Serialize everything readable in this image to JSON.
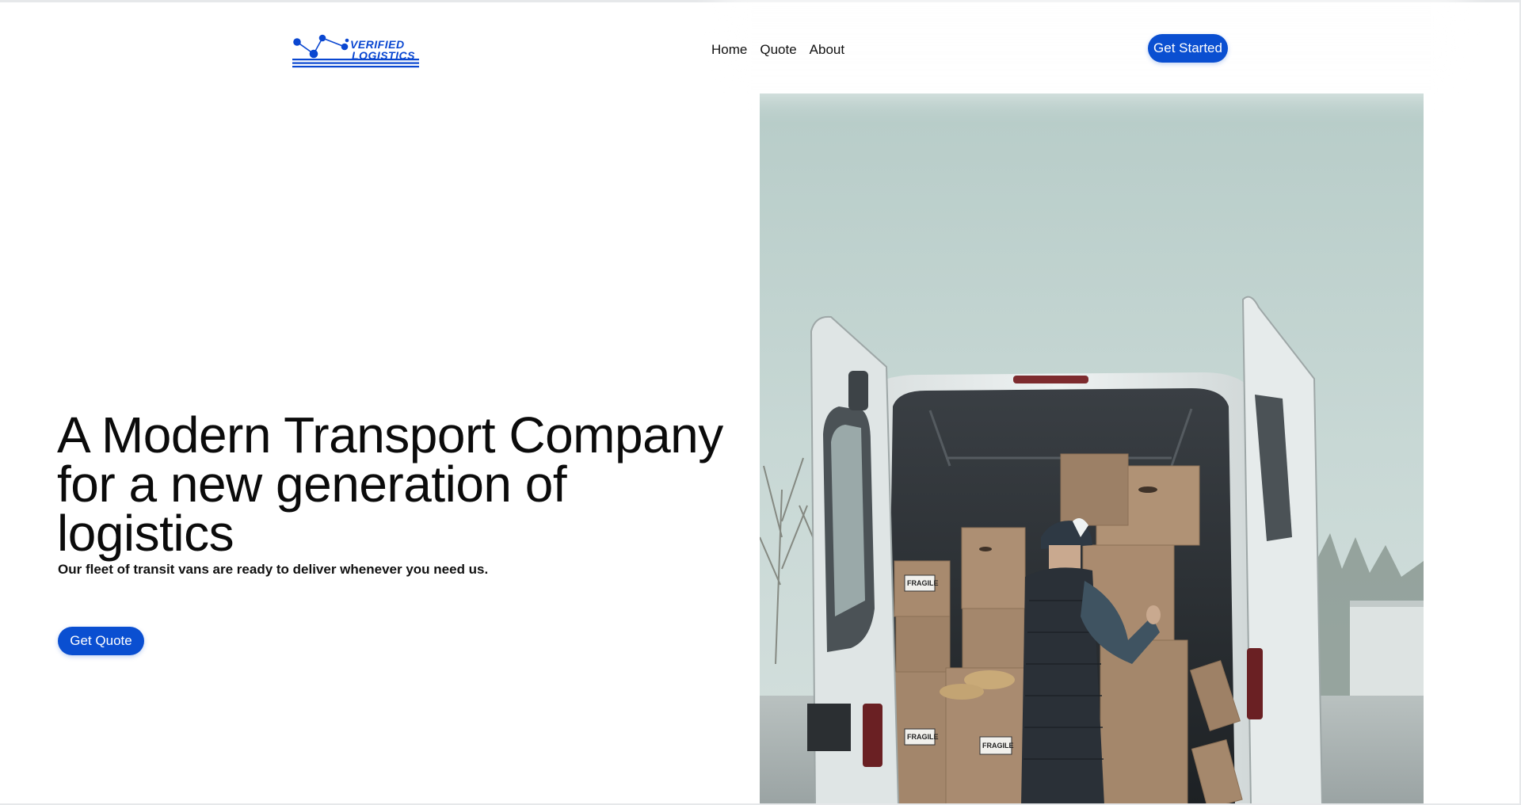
{
  "colors": {
    "accent": "#0a4fd1",
    "logo_blue": "#0a47d1",
    "text": "#0b0b0b",
    "background": "#ffffff"
  },
  "logo": {
    "line1": "VERIFIED",
    "line2": "LOGISTICS"
  },
  "nav": {
    "links": [
      {
        "label": "Home"
      },
      {
        "label": "Quote"
      },
      {
        "label": "About"
      }
    ],
    "cta_label": "Get Started"
  },
  "hero": {
    "title_line1": "A Modern Transport Company",
    "title_line2": "for a new generation of logistics",
    "subtitle": "Our fleet of transit vans are ready to deliver whenever you need us.",
    "cta_label": "Get Quote",
    "image_label": "FRAGILE"
  }
}
